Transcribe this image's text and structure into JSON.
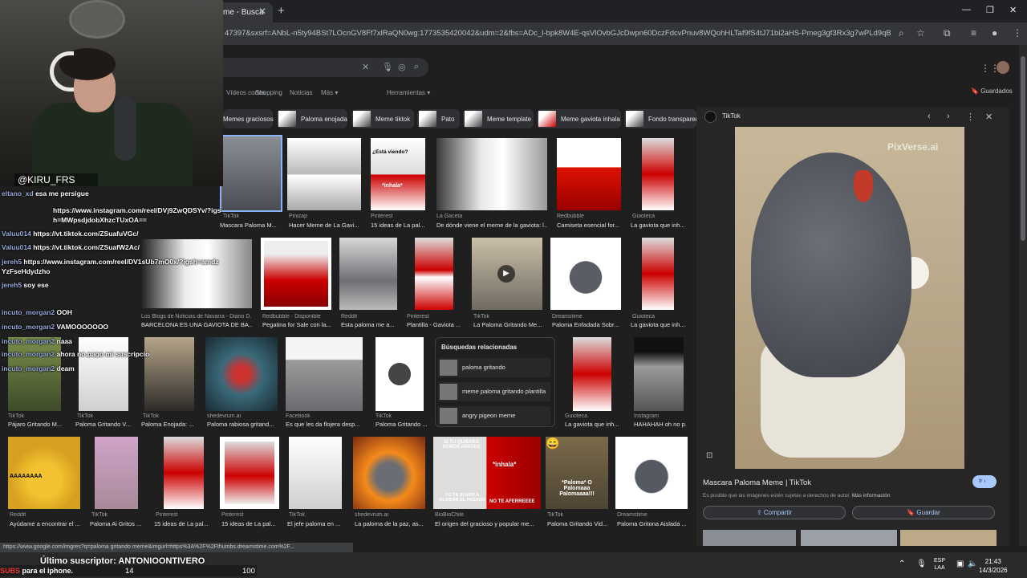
{
  "browser": {
    "tab_title": "me - Busca",
    "url": "47397&sxsrf=ANbL-n5ty94BSt7LOcnGV8Ff7xlRaQN0wg:1773535420042&udm=2&fbs=ADc_l-bpk8W4E-qsVlOvbGJcDwpn60DczFdcvPnuv8WQohHLTaf9fS4tJ71bi2aHS-Pmeg3gf3Rx3g7wPLd9qB5u5EuZ...",
    "status_url": "https://www.google.com/imgres?q=paloma gritando meme&imgurl=https%3A%2F%2Fthumbs.dreamstime.com%2F..."
  },
  "google": {
    "nav_tabs": [
      "Vídeos cortos",
      "Shopping",
      "Noticias",
      "Más",
      "Herramientas"
    ],
    "saved_label": "Guardados",
    "chips": [
      "Memes graciosos",
      "Paloma enojada",
      "Meme tiktok",
      "Pato",
      "Meme template",
      "Meme gaviota inhala",
      "Fondo transparente"
    ],
    "rows": [
      [
        {
          "src": "TikTok",
          "title": "Mascara Paloma M..."
        },
        {
          "src": "Pinizap",
          "title": "Hacer Meme de La Gavi..."
        },
        {
          "src": "Pinterest",
          "title": "15 ideas de La pal..."
        },
        {
          "src": "La Gaceta",
          "title": "De dónde viene el meme de la gaviota: l..."
        },
        {
          "src": "Redbubble",
          "title": "Camiseta esencial for..."
        },
        {
          "src": "Guioteca",
          "title": "La gaviota que inh..."
        }
      ],
      [
        {
          "src": "Los Blogs de Noticias de Navarra - Diario D...",
          "title": "BARCELONA ES UNA GAVIOTA DE BA..."
        },
        {
          "src": "Redbubble · Disponible",
          "title": "Pegatina for Sale con la..."
        },
        {
          "src": "Reddit",
          "title": "Esta paloma me a..."
        },
        {
          "src": "Pinterest",
          "title": "Plantilla - Gaviota ..."
        },
        {
          "src": "TikTok",
          "title": "La Paloma Gritando Me..."
        },
        {
          "src": "Dreamstime",
          "title": "Paloma Enfadada Sobr..."
        },
        {
          "src": "Guioteca",
          "title": "La gaviota que inh..."
        }
      ],
      [
        {
          "src": "TikTok",
          "title": "Pájaro Gritando M..."
        },
        {
          "src": "TikTok",
          "title": "Paloma Gritando V..."
        },
        {
          "src": "TikTok",
          "title": "Paloma Enojada: ..."
        },
        {
          "src": "shedevrum.ai",
          "title": "Paloma rabiosa gritand..."
        },
        {
          "src": "Facebook",
          "title": "Es que les da flojera desp..."
        },
        {
          "src": "TikTok",
          "title": "Paloma Gritando ..."
        },
        {
          "src": "Guioteca",
          "title": "La gaviota que inh..."
        },
        {
          "src": "Instagram",
          "title": "HAHAHAH oh no p..."
        }
      ],
      [
        {
          "src": "Reddit",
          "title": "Ayúdame a encontrar el ..."
        },
        {
          "src": "TikTok",
          "title": "Paloma Ai Gritos ..."
        },
        {
          "src": "Pinterest",
          "title": "15 ideas de La pal..."
        },
        {
          "src": "Pinterest",
          "title": "15 ideas de La pal..."
        },
        {
          "src": "TikTok",
          "title": "El jefe paloma en ..."
        },
        {
          "src": "shedevrum.ai",
          "title": "La paloma de la paz, as..."
        },
        {
          "src": "BioBioChile",
          "title": "El origen del gracioso y popular me..."
        },
        {
          "src": "TikTok",
          "title": "Paloma Gritando Vid..."
        },
        {
          "src": "Dreamstime",
          "title": "Paloma Gritona Aislada ..."
        }
      ]
    ],
    "related": {
      "heading": "Búsquedas relacionadas",
      "items": [
        "paloma gritando",
        "meme paloma gritando plantilla",
        "angry pigeon meme"
      ]
    },
    "meme_texts": {
      "inhala": "*inhala*",
      "esta_viendo": "¿Está viendo?",
      "si_tu_quieres": "SI TU QUIERES SEMOS AMIGOS",
      "yo_te_ayudo": "YO TE AYUDO A OLVIDAR EL PASADO",
      "no_te_aferres": "NO TE AFERREEEE",
      "palomaaa": "*Paloma* O Palomaaa Palomaaaa!!!"
    }
  },
  "panel": {
    "source": "TikTok",
    "watermark": "PixVerse.ai",
    "title": "Mascara Paloma Meme | TikTok",
    "note_prefix": "Es posible que las imágenes estén sujetas a derechos de autor.",
    "note_link": "Más información",
    "ir_label": "Ir",
    "share_label": "Compartir",
    "save_label": "Guardar"
  },
  "stream": {
    "username": "@KIRU_FRS",
    "chat": [
      {
        "user": "eltano_xd",
        "msg": "esa me persigue"
      },
      {
        "user": "",
        "msg": "https://www.instagram.com/reel/DVj9ZwQDSYv/?igsh=MWpsdjdobXhzcTUxOA=="
      },
      {
        "user": "Valuu014",
        "msg": "https://vt.tiktok.com/ZSuafuVGc/"
      },
      {
        "user": "Valuu014",
        "msg": "https://vt.tiktok.com/ZSuafW2Ac/"
      },
      {
        "user": "jereh5",
        "msg": "https://www.instagram.com/reel/DV1sUb7mO0x/?igsh=amdzYzFseHdydzho"
      },
      {
        "user": "jereh5",
        "msg": "soy ese"
      },
      {
        "user": "incuto_morgan2",
        "msg": "OOH"
      },
      {
        "user": "incuto_morgan2",
        "msg": "VAMOOOOOOO"
      },
      {
        "user": "incuto_morgan2",
        "msg": "naaa"
      },
      {
        "user": "incuto_morgan2",
        "msg": "ahora no pago mi suscripcion ahora"
      },
      {
        "user": "incuto_morgan2",
        "msg": "deam"
      }
    ],
    "last_sub_label": "Último suscriptor: ANTONIOONTIVERO",
    "subs_label": "SUBS",
    "subs_sub": "para el iphone.",
    "subs_current": "14",
    "subs_goal": "100"
  },
  "taskbar": {
    "lang": "ESP",
    "region": "LAA",
    "time": "21:43",
    "date": "14/3/2026"
  }
}
